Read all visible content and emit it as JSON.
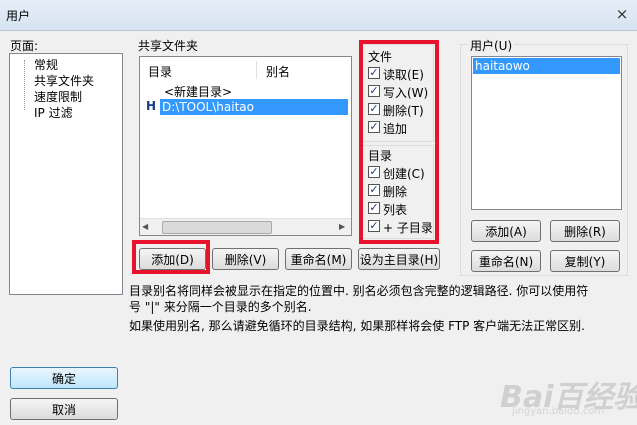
{
  "window": {
    "title": "用户",
    "close_symbol": "×"
  },
  "pages_panel": {
    "label": "页面:",
    "items": [
      "常规",
      "共享文件夹",
      "速度限制",
      "IP 过滤"
    ]
  },
  "shared_folders": {
    "group_label": "共享文件夹",
    "columns": [
      "目录",
      "别名"
    ],
    "rows": [
      {
        "marker": "",
        "path": "<新建目录>"
      },
      {
        "marker": "H",
        "path": "D:\\TOOL\\haitao"
      }
    ],
    "buttons": {
      "add": "添加(D)",
      "delete": "删除(V)",
      "rename": "重命名(M)",
      "set_home": "设为主目录(H)"
    },
    "help_text_1": "目录别名将同样会被显示在指定的位置中. 别名必须包含完整的逻辑路径. 你可以使用符号 \"|\" 来分隔一个目录的多个别名.",
    "help_text_2": "如果使用别名, 那么请避免循环的目录结构, 如果那样将会使 FTP 客户端无法正常区别."
  },
  "permissions": {
    "files_label": "文件",
    "files": [
      {
        "label": "读取(E)",
        "checked": true
      },
      {
        "label": "写入(W)",
        "checked": true
      },
      {
        "label": "删除(T)",
        "checked": true
      },
      {
        "label": "追加",
        "checked": true
      }
    ],
    "dirs_label": "目录",
    "dirs": [
      {
        "label": "创建(C)",
        "checked": true
      },
      {
        "label": "删除",
        "checked": true
      },
      {
        "label": "列表",
        "checked": true
      },
      {
        "label": "+ 子目录",
        "checked": true
      }
    ],
    "check_mark": "✓"
  },
  "users": {
    "group_label": "用户(U)",
    "list": [
      "haitaowo"
    ],
    "buttons": {
      "add": "添加(A)",
      "delete": "删除(R)",
      "rename": "重命名(N)",
      "copy": "复制(Y)"
    }
  },
  "dialog_buttons": {
    "ok": "确定",
    "cancel": "取消"
  },
  "watermark": {
    "brand": "Bai百经验",
    "url": "jingyan.baidu.com"
  },
  "colors": {
    "highlight": "#e8122d",
    "selection": "#3399ff"
  }
}
